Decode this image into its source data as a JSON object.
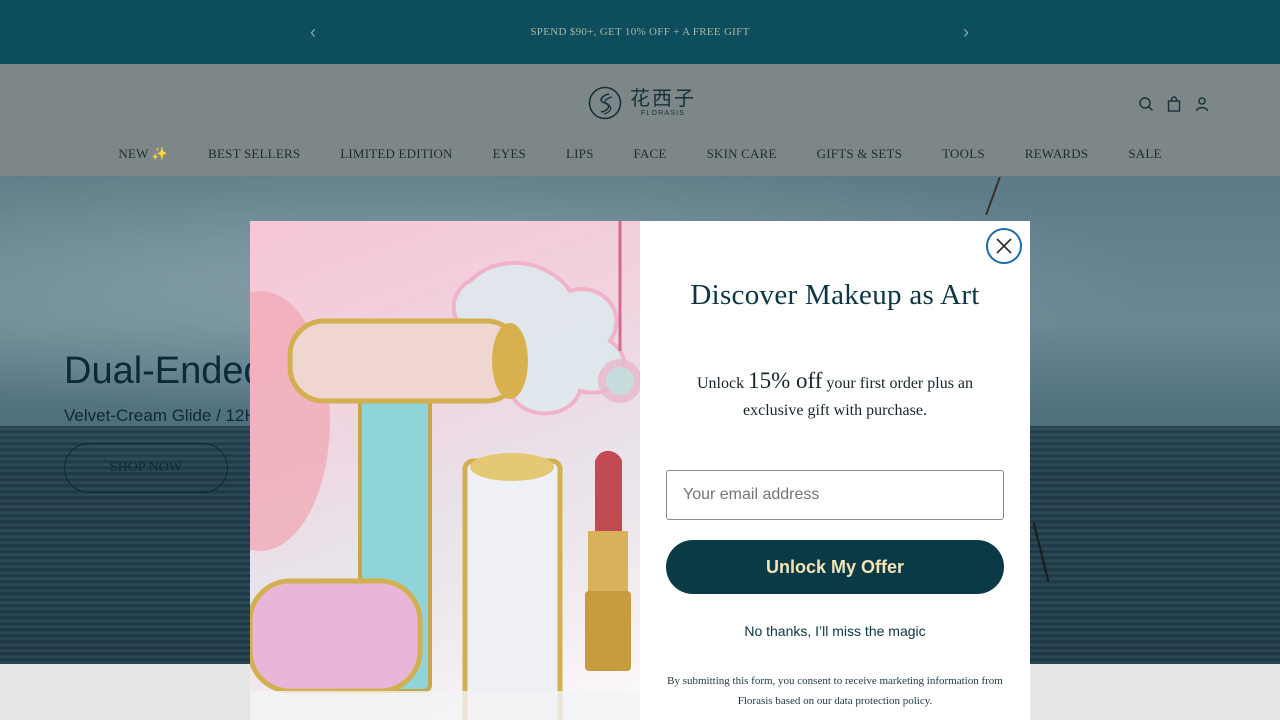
{
  "announcement": {
    "text": "SPEND $90+, GET 10% OFF + A FREE GIFT",
    "prev_icon": "chevron-left-icon",
    "next_icon": "chevron-right-icon"
  },
  "header": {
    "logo_cn": "花西子",
    "logo_en": "FLORASIS",
    "icons": [
      "search-icon",
      "bag-icon",
      "account-icon"
    ],
    "nav": [
      "NEW ✨",
      "BEST SELLERS",
      "LIMITED EDITION",
      "EYES",
      "LIPS",
      "FACE",
      "SKIN CARE",
      "GIFTS & SETS",
      "TOOLS",
      "REWARDS",
      "SALE"
    ]
  },
  "hero": {
    "title": "Dual-Ended",
    "subtitle": "Velvet-Cream Glide / 12H",
    "button": "SHOP NOW"
  },
  "modal": {
    "title": "Discover Makeup as Art",
    "offer_prefix": "Unlock ",
    "offer_highlight": "15% off",
    "offer_suffix": " your first order plus an exclusive gift with purchase.",
    "email_placeholder": "Your email address",
    "submit_label": "Unlock My Offer",
    "decline_label": "No thanks, I’ll miss the magic",
    "disclaimer": "By submitting this form, you consent to receive marketing information from Florasis based on our data protection policy.",
    "close_icon": "close-icon"
  },
  "colors": {
    "announcement_bg": "#0d4e5e",
    "brand_dark": "#0b3a47",
    "button_text": "#f4e3b5",
    "close_ring": "#1d6aa8"
  }
}
